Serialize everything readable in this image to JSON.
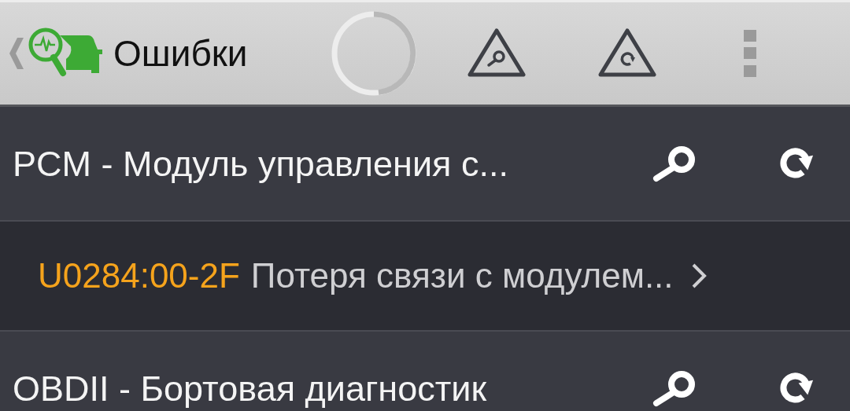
{
  "header": {
    "title": "Ошибки",
    "loading": true
  },
  "modules": [
    {
      "name": "PCM - Модуль управления с...",
      "errors": [
        {
          "code": "U0284:00-2F",
          "description": "Потеря связи с модулем..."
        }
      ]
    },
    {
      "name": "OBDII - Бортовая диагностик"
    }
  ]
}
